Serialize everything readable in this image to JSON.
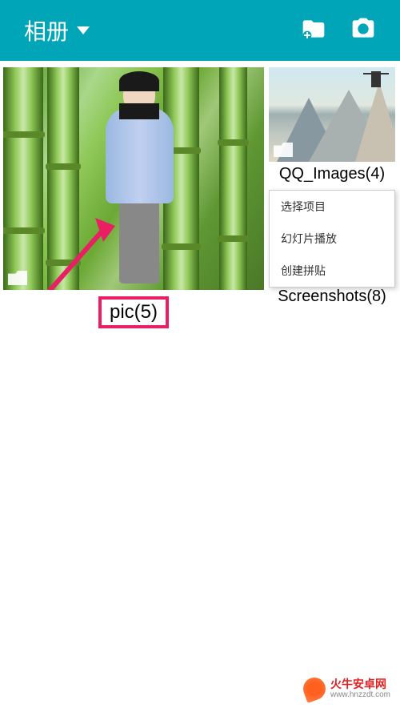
{
  "header": {
    "title": "相册"
  },
  "albums": {
    "pic": {
      "label": "pic(5)"
    },
    "qq_images": {
      "label": "QQ_Images(4)"
    },
    "screenshots": {
      "label": "Screenshots(8)"
    }
  },
  "context_menu": {
    "items": [
      "选择项目",
      "幻灯片播放",
      "创建拼贴"
    ]
  },
  "watermark": {
    "main": "火牛安卓网",
    "sub": "www.hnzzdt.com"
  }
}
